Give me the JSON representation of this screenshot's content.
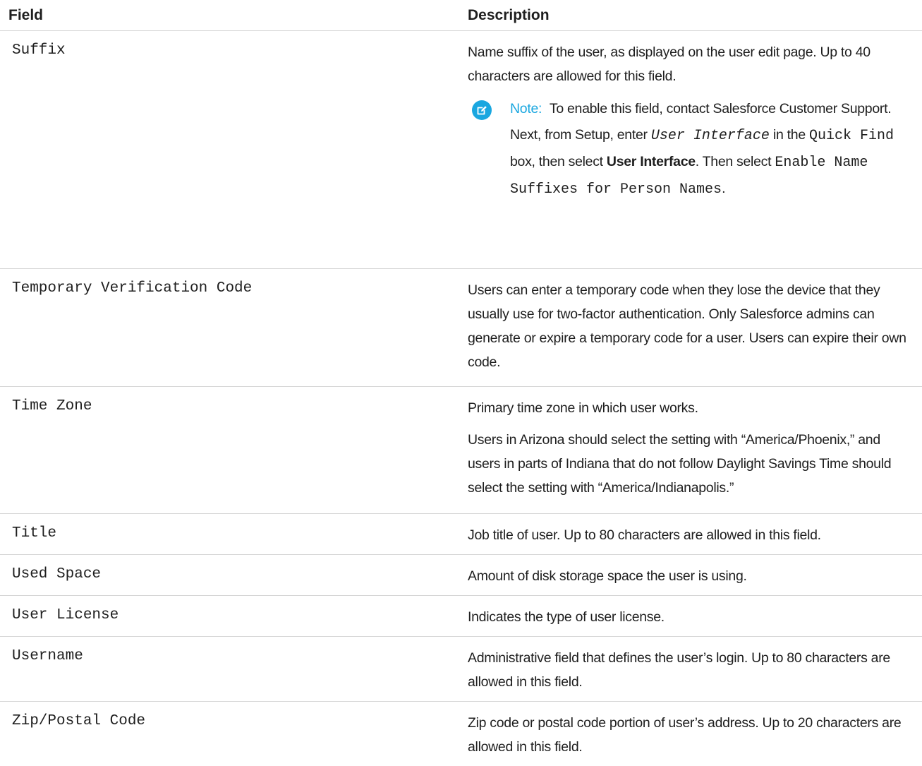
{
  "table": {
    "headers": {
      "field": "Field",
      "description": "Description"
    },
    "rows": [
      {
        "field": "Suffix",
        "paragraphs": [
          "Name suffix of the user, as displayed on the user edit page. Up to 40 characters are allowed for this field."
        ],
        "note": {
          "label": "Note:",
          "t1": "To enable this field, contact Salesforce Customer Support. Next, from Setup, enter",
          "code1": "User Interface",
          "t2": "in the",
          "code2": "Quick Find",
          "t3": "box, then select",
          "bold1": "User Interface",
          "t4": ". Then select",
          "code3": "Enable Name Suffixes for Person Names",
          "t5": "."
        }
      },
      {
        "field": "Temporary Verification Code",
        "paragraphs": [
          "Users can enter a temporary code when they lose the device that they usually use for two-factor authentication. Only Salesforce admins can generate or expire a temporary code for a user. Users can expire their own code."
        ]
      },
      {
        "field": "Time Zone",
        "paragraphs": [
          "Primary time zone in which user works.",
          "Users in Arizona should select the setting with “America/Phoenix,” and users in parts of Indiana that do not follow Daylight Savings Time should select the setting with “America/Indianapolis.”"
        ]
      },
      {
        "field": "Title",
        "paragraphs": [
          "Job title of user. Up to 80 characters are allowed in this field."
        ]
      },
      {
        "field": "Used Space",
        "paragraphs": [
          "Amount of disk storage space the user is using."
        ]
      },
      {
        "field": "User License",
        "paragraphs": [
          "Indicates the type of user license."
        ]
      },
      {
        "field": "Username",
        "paragraphs": [
          "Administrative field that defines the user’s login. Up to 80 characters are allowed in this field."
        ]
      },
      {
        "field": "Zip/Postal Code",
        "paragraphs": [
          "Zip code or postal code portion of user’s address. Up to 20 characters are allowed in this field."
        ]
      }
    ]
  },
  "colors": {
    "accent": "#1aa7e0",
    "text": "#1e1e1e",
    "divider": "#d6d6d6"
  },
  "icons": {
    "note": "edit-note-icon"
  }
}
